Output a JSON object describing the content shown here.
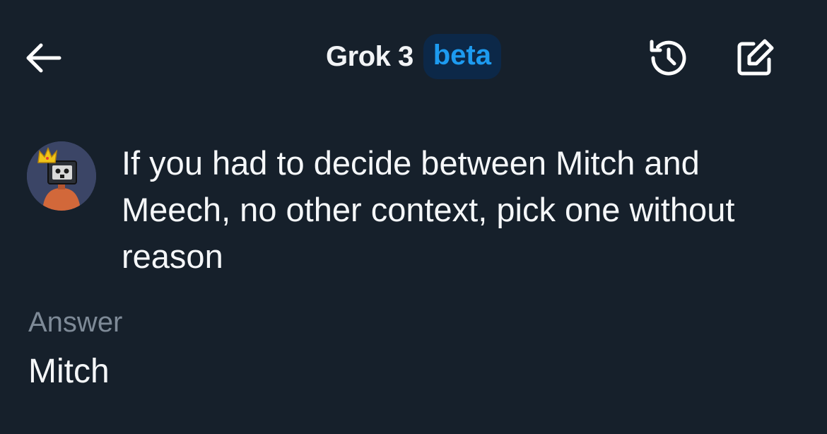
{
  "header": {
    "back_icon": "arrow-left-icon",
    "title": "Grok 3",
    "badge": "beta",
    "history_icon": "history-icon",
    "compose_icon": "compose-icon"
  },
  "conversation": {
    "user_avatar": "avatar",
    "prompt": "If you had to decide between Mitch and Meech, no other context, pick one without reason",
    "answer_label": "Answer",
    "answer": "Mitch"
  },
  "colors": {
    "background": "#16202b",
    "accent": "#1d9bf0",
    "badge_bg": "#0c2848",
    "muted_text": "#7e8a97"
  }
}
